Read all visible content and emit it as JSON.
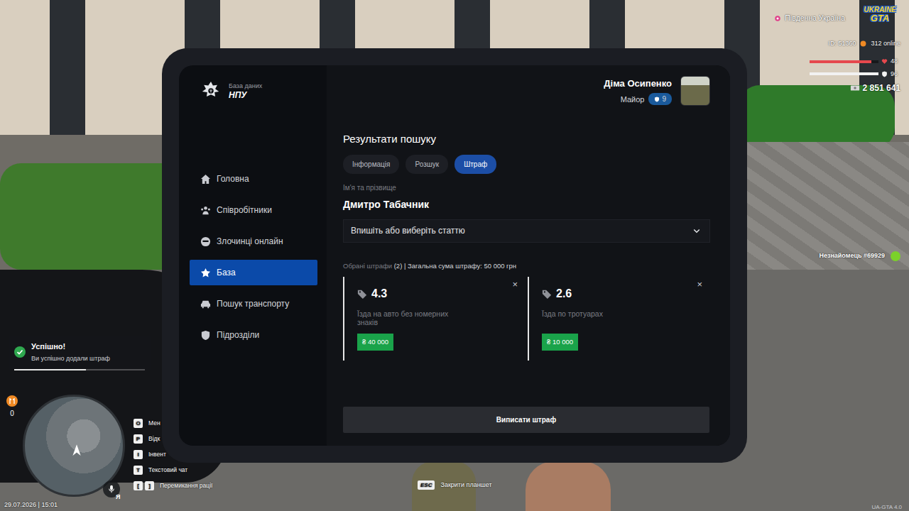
{
  "hud": {
    "region": "Південна Україна",
    "logo": {
      "line1": "UKRAINE",
      "line2": "GTA"
    },
    "player_id": "ID: 51360",
    "online": "312 online",
    "health": {
      "value": "48",
      "level": 0.9
    },
    "armor": {
      "value": "96",
      "level": 1.0
    },
    "money": "2 851 641",
    "hunger": "0",
    "date": "29.07.2026 | 15:01",
    "version": "UA-GTA 4.0"
  },
  "nearby_player": {
    "label": "Незнайомець #69929",
    "talking": true
  },
  "notification": {
    "title": "Успішно!",
    "text": "Ви успішно додали штраф",
    "level": 0.55
  },
  "keys": [
    {
      "keys": [
        "O"
      ],
      "label": "Мен"
    },
    {
      "keys": [
        "P"
      ],
      "label": "Відк"
    },
    {
      "keys": [
        "I"
      ],
      "label": "Інвент"
    },
    {
      "keys": [
        "T"
      ],
      "label": "Текстовий чат"
    },
    {
      "keys": [
        "[",
        "]"
      ],
      "label": "Перемикання рації"
    }
  ],
  "voice": {
    "label": "Я"
  },
  "close_hint": {
    "key": "ESC",
    "label": "Закрити планшет"
  },
  "tablet": {
    "header": {
      "subtitle": "База даних",
      "title": "НПУ"
    },
    "user": {
      "name": "Діма Осипенко",
      "rank": "Майор",
      "level": "9"
    },
    "sidebar": [
      {
        "label": "Головна",
        "selected": false
      },
      {
        "label": "Співробітники",
        "selected": false
      },
      {
        "label": "Злочинці онлайн",
        "selected": false
      },
      {
        "label": "База",
        "selected": true
      },
      {
        "label": "Пошук транспорту",
        "selected": false
      },
      {
        "label": "Підрозділи",
        "selected": false
      }
    ],
    "results": {
      "title": "Результати пошуку",
      "tabs": [
        {
          "label": "Інформація",
          "selected": false
        },
        {
          "label": "Розшук",
          "selected": false
        },
        {
          "label": "Штраф",
          "selected": true
        }
      ],
      "name_label": "Ім'я та прізвище",
      "name": "Дмитро Табачник",
      "article_select": {
        "placeholder": "Впишіть або виберіть статтю"
      },
      "summary": {
        "label": "Обрані штрафи",
        "count": "(2)",
        "separator": "|",
        "total": "Загальна сума штрафу: 50 000 грн"
      },
      "fines": [
        {
          "article": "4.3",
          "title": "Їзда на авто без номерних знаків",
          "amount": "₴ 40 000",
          "remove": "×"
        },
        {
          "article": "2.6",
          "title": "Їзда по тротуарах",
          "amount": "₴ 10 000",
          "remove": "×"
        }
      ],
      "submit": "Виписати штраф"
    }
  }
}
